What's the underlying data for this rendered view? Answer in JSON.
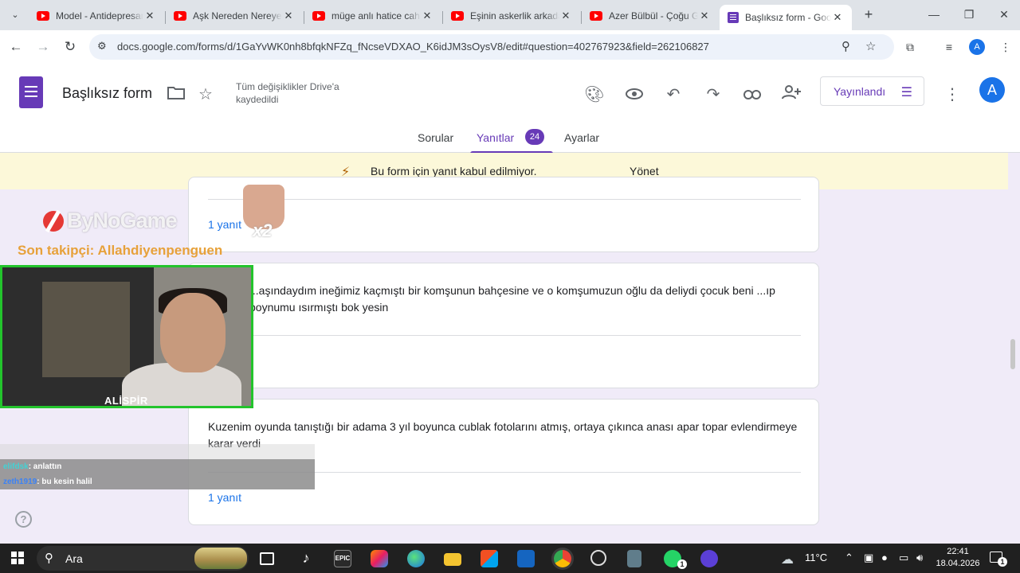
{
  "browser": {
    "tabs": [
      {
        "title": "Model - Antidepresan",
        "icon": "youtube-icon",
        "active": false
      },
      {
        "title": "Aşk Nereden Nereye",
        "icon": "youtube-icon",
        "active": false
      },
      {
        "title": "müge anlı hatice cahit",
        "icon": "youtube-icon",
        "active": false
      },
      {
        "title": "Eşinin askerlik arkadaşı",
        "icon": "youtube-icon",
        "active": false
      },
      {
        "title": "Azer Bülbül - Çoğu Gitti",
        "icon": "youtube-icon",
        "active": false
      },
      {
        "title": "Başlıksız form - Google Formlar",
        "icon": "google-forms-icon",
        "active": true
      }
    ],
    "url": "docs.google.com/forms/d/1GaYvWK0nh8bfqkNFZq_fNcseVDXAO_K6idJM3sOysV8/edit#question=402767923&field=262106827",
    "profile_initial": "A"
  },
  "form": {
    "title": "Başlıksız form",
    "save_status": "Tüm değişiklikler Drive'a kaydedildi",
    "publish_label": "Yayınlandı",
    "avatar_initial": "A",
    "tabs": [
      {
        "label": "Sorular"
      },
      {
        "label": "Yanıtlar",
        "badge": "24",
        "active": true
      },
      {
        "label": "Ayarlar"
      }
    ],
    "banner": {
      "text": "Bu form için yanıt kabul edilmiyor.",
      "action": "Yönet"
    },
    "responses": [
      {
        "text": "",
        "count_label": "1 yanıt"
      },
      {
        "text": "...aşındaydım ineğimiz kaçmıştı bir komşunun bahçesine ve o komşumuzun oğlu da deliydi çocuk beni ...ıp boynumu ısırmıştı bok yesin",
        "count_label": ""
      },
      {
        "text": "Kuzenim oyunda tanıştığı bir adama 3 yıl boyunca cublak fotolarını atmış, ortaya çıkınca anası apar topar evlendirmeye karar verdi",
        "count_label": "1 yanıt"
      }
    ]
  },
  "stream": {
    "brand": "ByNoGame",
    "last_follower": "Son takipçi: Allahdiyenpenguen",
    "streamer_name": "ALİSPİR",
    "sticker_multiplier": "x2",
    "chat": [
      {
        "user": "elifdsk",
        "message": ": anlattın"
      },
      {
        "user": "zeth1919",
        "message": ": bu kesin halil"
      }
    ]
  },
  "taskbar": {
    "search_placeholder": "Ara",
    "weather": "11°C",
    "time": "22:41",
    "date": "18.04.2026",
    "notification_count": "1",
    "whatsapp_badge": "1"
  }
}
